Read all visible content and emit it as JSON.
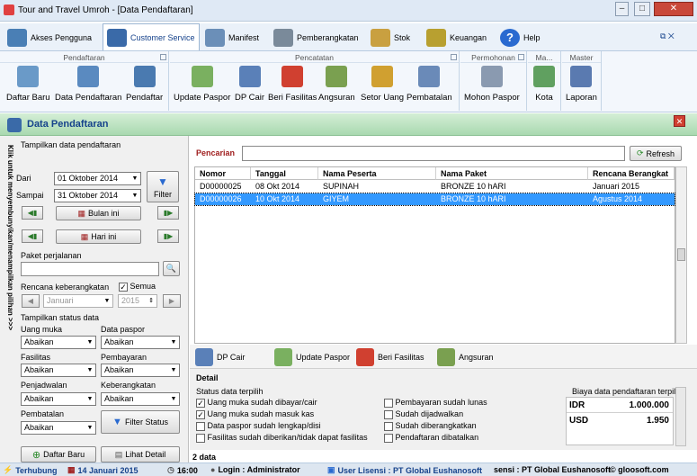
{
  "window": {
    "title": "Tour and Travel Umroh - [Data Pendaftaran]"
  },
  "menu": [
    {
      "label": "Akses Pengguna",
      "icon": "users-icon",
      "color": "#4a7fb5"
    },
    {
      "label": "Customer Service",
      "icon": "customer-service-icon",
      "color": "#3a6aa8",
      "active": true
    },
    {
      "label": "Manifest",
      "icon": "manifest-icon",
      "color": "#6b8fb8"
    },
    {
      "label": "Pemberangkatan",
      "icon": "airplane-icon",
      "color": "#7a8a9a"
    },
    {
      "label": "Stok",
      "icon": "box-icon",
      "color": "#c9a040"
    },
    {
      "label": "Keuangan",
      "icon": "money-icon",
      "color": "#b8a030"
    },
    {
      "label": "Help",
      "icon": "help-icon",
      "color": "#2a6ad0"
    }
  ],
  "ribbon": {
    "groups": [
      {
        "title": "Pendaftaran",
        "buttons": [
          "Daftar Baru",
          "Data Pendaftaran",
          "Pendaftar"
        ]
      },
      {
        "title": "Pencatatan",
        "buttons": [
          "Update Paspor",
          "DP Cair",
          "Beri Fasilitas",
          "Angsuran",
          "Setor Uang",
          "Pembatalan"
        ]
      },
      {
        "title": "Permohonan",
        "buttons": [
          "Mohon Paspor"
        ]
      },
      {
        "title": "Ma...",
        "buttons": [
          "Kota"
        ]
      },
      {
        "title": "Master",
        "buttons": [
          "Laporan"
        ]
      }
    ]
  },
  "panel": {
    "title": "Data Pendaftaran",
    "vertical_hint": "Klik untuk menyembunyikan/menampilkan pilihan >>>"
  },
  "filter": {
    "section_label": "Tampilkan data pendaftaran",
    "dari_label": "Dari",
    "dari_value": "01  Oktober  2014",
    "sampai_label": "Sampai",
    "sampai_value": "31  Oktober  2014",
    "filter_button": "Filter",
    "bulan_ini": "Bulan ini",
    "hari_ini": "Hari ini",
    "paket_label": "Paket perjalanan",
    "paket_value": "",
    "rencana_label": "Rencana keberangkatan",
    "semua_label": "Semua",
    "bulan_value": "Januari",
    "tahun_value": "2015",
    "status_label": "Tampilkan status data",
    "uang_muka_label": "Uang muka",
    "data_paspor_label": "Data paspor",
    "fasilitas_label": "Fasilitas",
    "pembayaran_label": "Pembayaran",
    "penjadwalan_label": "Penjadwalan",
    "keberangkatan_label": "Keberangkatan",
    "pembatalan_label": "Pembatalan",
    "abaikan": "Abaikan",
    "filter_status_button": "Filter Status",
    "daftar_baru_button": "Daftar Baru",
    "lihat_detail_button": "Lihat Detail"
  },
  "search": {
    "label": "Pencarian",
    "value": "",
    "refresh": "Refresh"
  },
  "table": {
    "columns": [
      "Nomor",
      "Tanggal",
      "Nama Peserta",
      "Nama Paket",
      "Rencana Berangkat"
    ],
    "rows": [
      [
        "D00000025",
        "08 Okt 2014",
        "SUPINAH",
        "BRONZE 10 hARI",
        "Januari 2015"
      ],
      [
        "D00000026",
        "10 Okt 2014",
        "GIYEM",
        "BRONZE 10 hARI",
        "Agustus 2014"
      ]
    ],
    "selected_row": 1
  },
  "actions": [
    "DP Cair",
    "Update Paspor",
    "Beri Fasilitas",
    "Angsuran"
  ],
  "detail": {
    "title": "Detail",
    "status_title": "Status data terpilih",
    "checks_left": [
      {
        "label": "Uang muka sudah dibayar/cair",
        "checked": true
      },
      {
        "label": "Uang muka sudah masuk kas",
        "checked": true
      },
      {
        "label": "Data paspor sudah lengkap/disi",
        "checked": false
      },
      {
        "label": "Fasilitas sudah diberikan/tidak dapat fasilitas",
        "checked": false
      }
    ],
    "checks_right": [
      {
        "label": "Pembayaran sudah lunas",
        "checked": false
      },
      {
        "label": "Sudah dijadwalkan",
        "checked": false
      },
      {
        "label": "Sudah diberangkatkan",
        "checked": false
      },
      {
        "label": "Pendaftaran dibatalkan",
        "checked": false
      }
    ],
    "biaya_title": "Biaya data pendaftaran terpilih",
    "idr_label": "IDR",
    "idr_value": "1.000.000",
    "usd_label": "USD",
    "usd_value": "1.950"
  },
  "footer": {
    "count": "2 data"
  },
  "statusbar": {
    "connection": "Terhubung",
    "date": "14 Januari 2015",
    "time": "16:00",
    "login": "Login : Administrator",
    "license": "User Lisensi : PT Global Eushanosoft",
    "license2": "sensi : PT Global Eushanosoft",
    "site": "© gloosoft.com"
  }
}
